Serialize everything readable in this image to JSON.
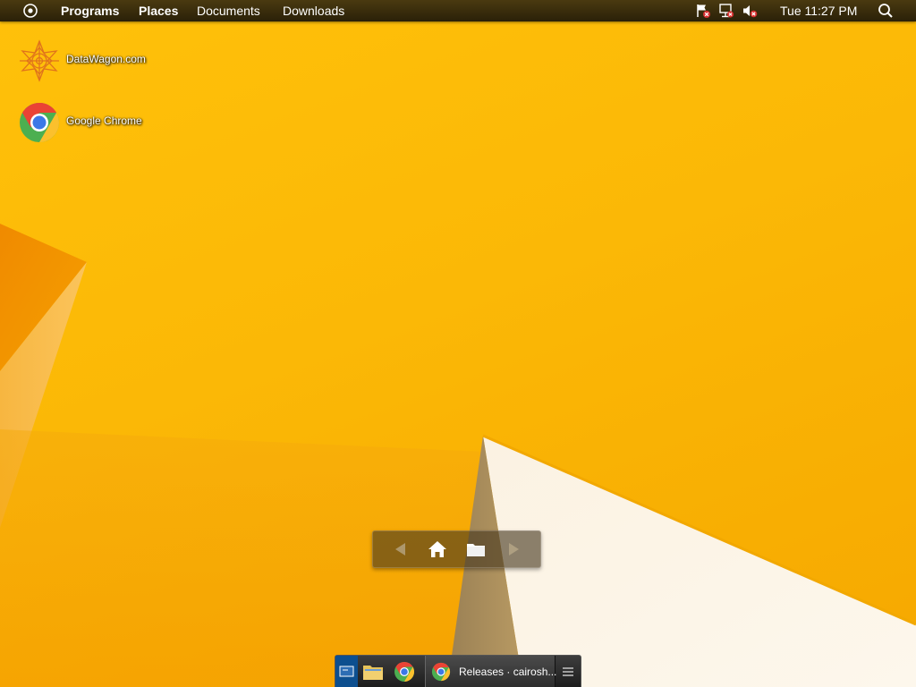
{
  "top_panel": {
    "menu": [
      "Programs",
      "Places",
      "Documents",
      "Downloads"
    ],
    "tray_icons": [
      "flag-alert-icon",
      "network-disconnected-icon",
      "volume-muted-icon"
    ],
    "clock": "Tue 11:27 PM",
    "search_icon": "search-icon",
    "start_icon": "start-menu-icon"
  },
  "desktop": {
    "shortcuts": [
      {
        "label": "DataWagon.com",
        "icon": "datawagon-logo-icon"
      },
      {
        "label": "Google Chrome",
        "icon": "chrome-icon"
      }
    ]
  },
  "navigator": {
    "buttons": [
      "back-arrow-icon",
      "home-icon",
      "folder-icon",
      "forward-arrow-icon"
    ]
  },
  "taskbar": {
    "launchers": [
      "show-desktop-icon",
      "file-manager-icon",
      "chrome-icon"
    ],
    "windows": [
      {
        "label": "Releases · cairosh...",
        "icon": "chrome-icon"
      }
    ],
    "menu_icon": "hamburger-menu-icon"
  },
  "colors": {
    "wallpaper": "#fbb806",
    "panel": "#2a2008",
    "accent": "#0d4f8f"
  }
}
